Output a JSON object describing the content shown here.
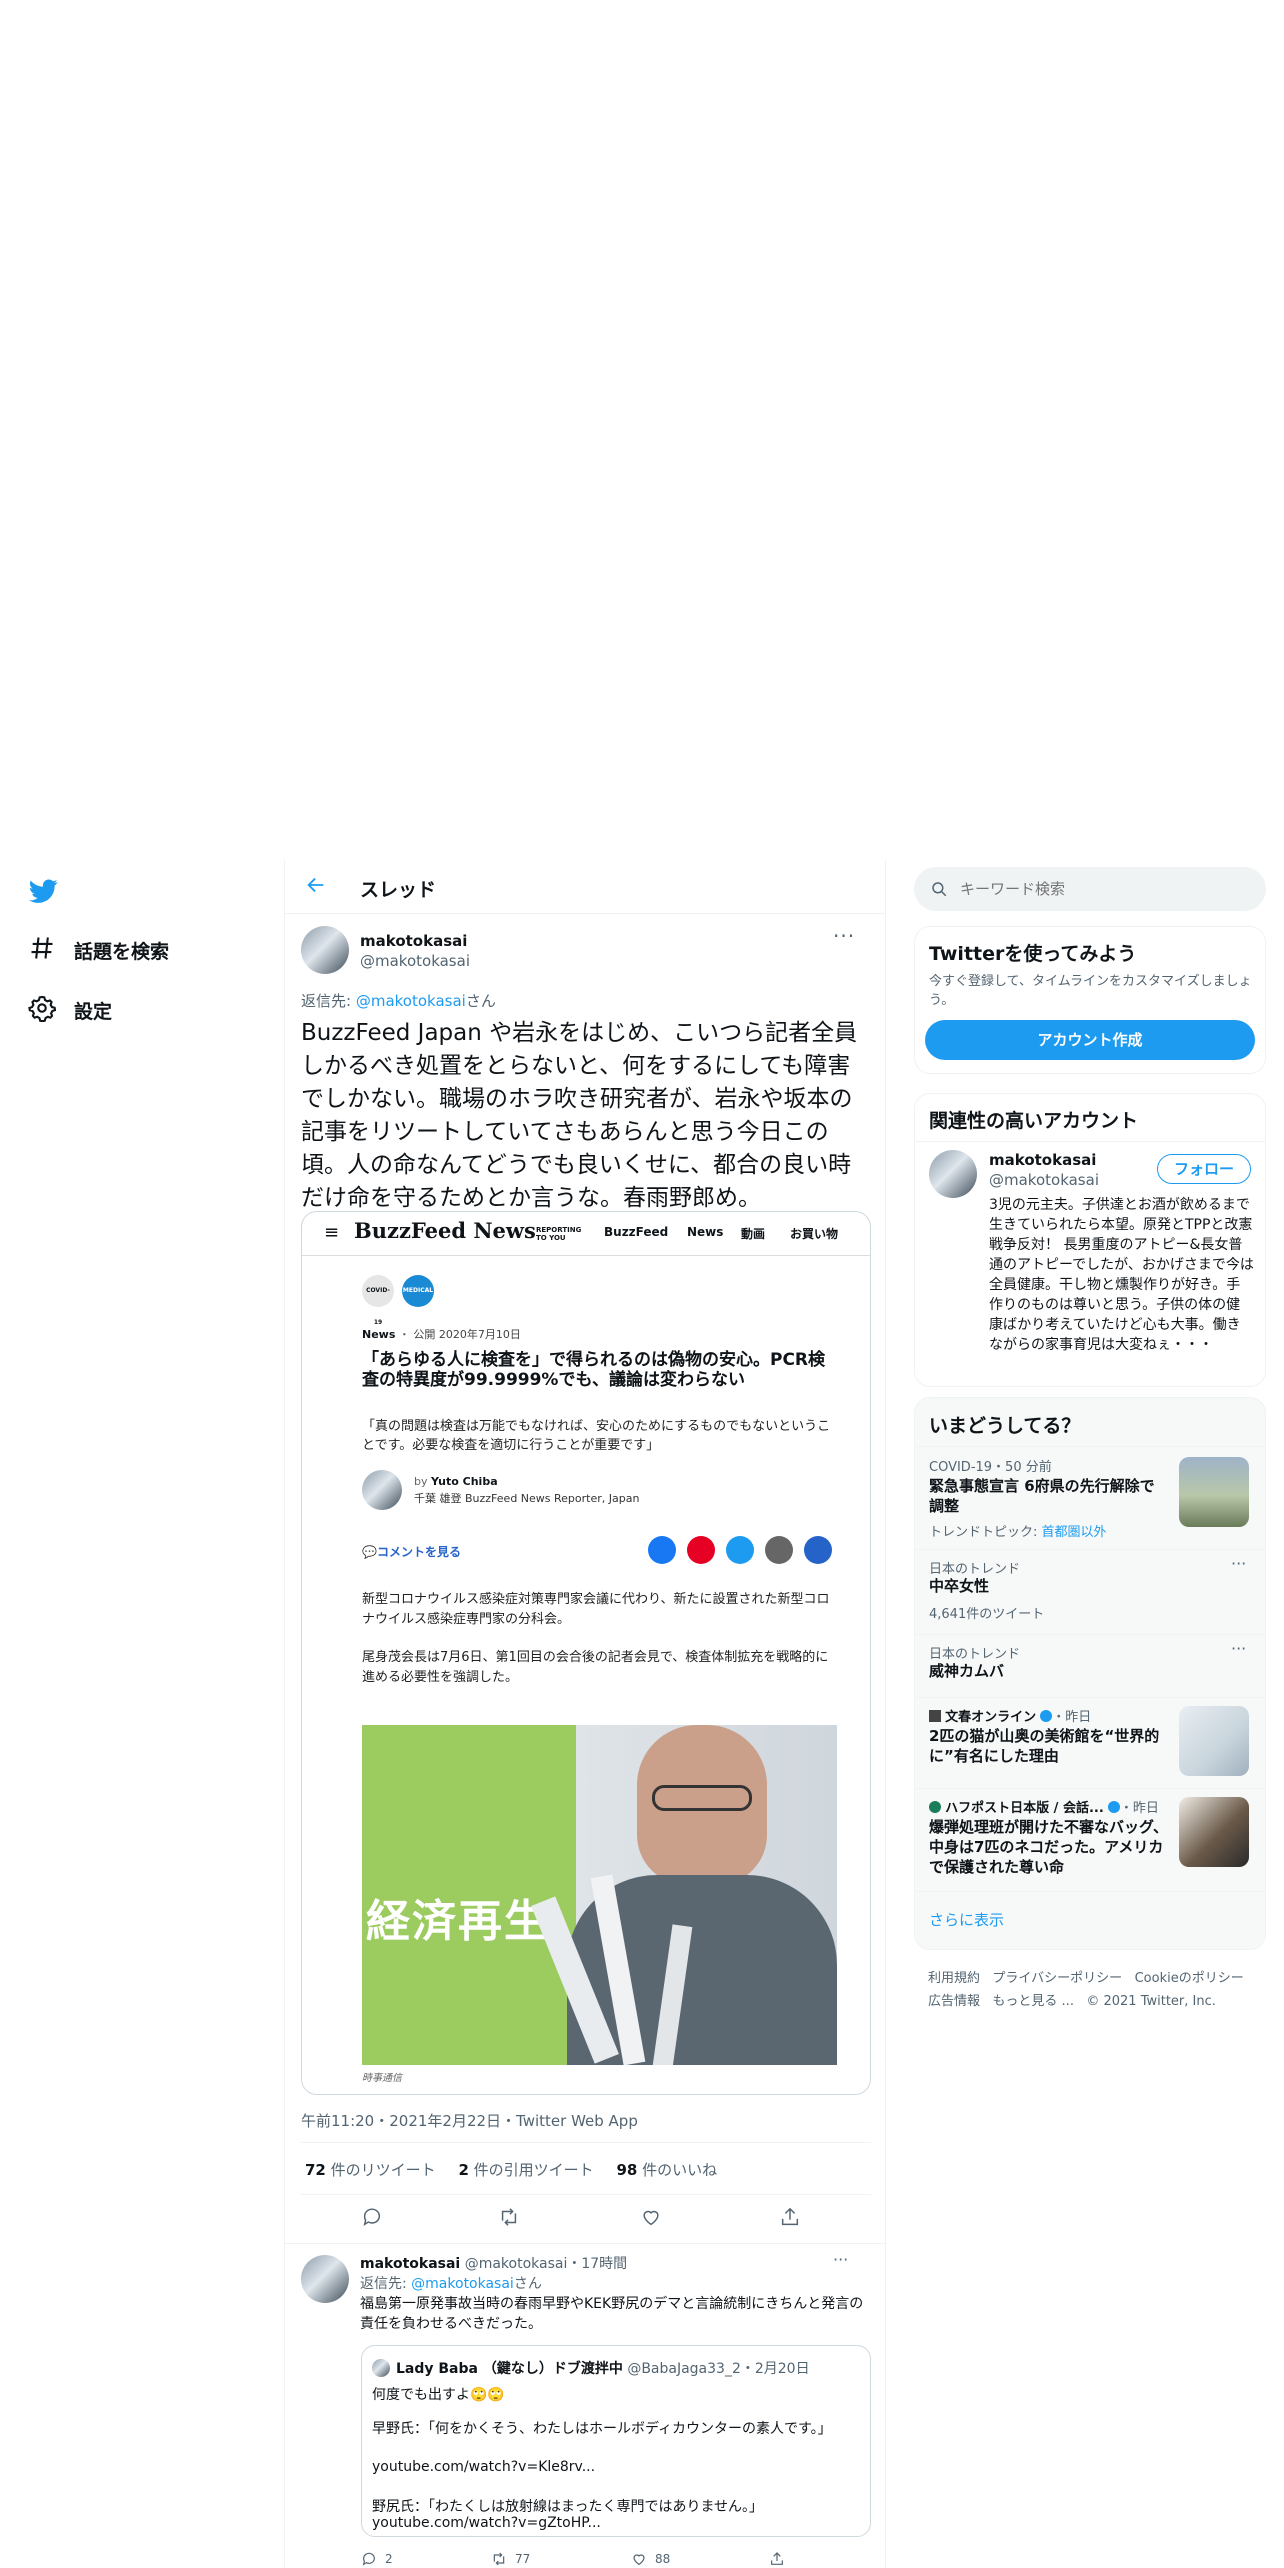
{
  "nav": {
    "items": [
      {
        "label": "話題を検索",
        "icon": "hashtag-icon"
      },
      {
        "label": "設定",
        "icon": "gear-icon"
      }
    ]
  },
  "header": {
    "title": "スレッド"
  },
  "main_tweet": {
    "display_name": "makotokasai",
    "handle": "@makotokasai",
    "reply_prefix": "返信先: ",
    "reply_to": "@makotokasai",
    "reply_suffix": "さん",
    "text": "BuzzFeed Japan や岩永をはじめ、こいつら記者全員しかるべき処置をとらないと、何をするにしても障害でしかない。職場のホラ吹き研究者が、岩永や坂本の記事をリツートしていてさもあらんと思う今日この頃。人の命なんてどうでも良いくせに、都合の良い時だけ命を守るためとか言うな。春雨野郎め。",
    "timestamp": "午前11:20・2021年2月22日・Twitter Web App",
    "stats": {
      "retweets_count": "72",
      "retweets_label": "件のリツイート",
      "quotes_count": "2",
      "quotes_label": "件の引用ツイート",
      "likes_count": "98",
      "likes_label": "件のいいね"
    }
  },
  "article": {
    "logo": "BuzzFeed News",
    "logo_sub": "REPORTING TO YOU",
    "nav": [
      "BuzzFeed",
      "News",
      "動画",
      "お買い物"
    ],
    "badge1": "COVID-19",
    "badge2": "MEDICAL",
    "category": "News",
    "date": "公開 2020年7月10日",
    "headline": "「あらゆる人に検査を」で得られるのは偽物の安心。PCR検査の特異度が99.9999%でも、議論は変わらない",
    "lede": "「真の問題は検査は万能でもなければ、安心のためにするものでもないということです。必要な検査を適切に行うことが重要です」",
    "byline_prefix": "by",
    "author": "Yuto Chiba",
    "author_title": "千葉 雄登 BuzzFeed News Reporter, Japan",
    "comment_link": "コメントを見る",
    "para1": "新型コロナウイルス感染症対策専門家会議に代わり、新たに設置された新型コロナウイルス感染症専門家の分科会。",
    "para2": "尾身茂会長は7月6日、第1回目の会合後の記者会見で、検査体制拡充を戦略的に進める必要性を強調した。",
    "photo_sign": "経済再生",
    "photo_credit": "時事通信"
  },
  "reply_tweet": {
    "display_name": "makotokasai",
    "meta": "@makotokasai・17時間",
    "reply_prefix": "返信先: ",
    "reply_to": "@makotokasai",
    "reply_suffix": "さん",
    "text": "福島第一原発事故当時の春雨早野やKEK野尻のデマと言論統制にきちんと発言の責任を負わせるべきだった。",
    "quote": {
      "name": "Lady Baba （鍵なし）ドブ渡拌中",
      "meta": "@BabaJaga33_2・2月20日",
      "line1": "何度でも出すよ🙄🙄",
      "line2": "早野氏：「何をかくそう、わたしはホールボディカウンターの素人です。」",
      "link1": "youtube.com/watch?v=Kle8rv...",
      "line3": "野尻氏：「わたくしは放射線はまったく専門ではありません。」",
      "link2": "youtube.com/watch?v=gZtoHP..."
    },
    "reply_count": "2",
    "retweet_count": "77",
    "like_count": "88"
  },
  "search": {
    "placeholder": "キーワード検索"
  },
  "signup": {
    "title": "Twitterを使ってみよう",
    "desc": "今すぐ登録して、タイムラインをカスタマイズしましょう。",
    "button": "アカウント作成"
  },
  "related": {
    "title": "関連性の高いアカウント",
    "name": "makotokasai",
    "handle": "@makotokasai",
    "follow": "フォロー",
    "bio": "3児の元主夫。子供達とお酒が飲めるまで生きていられたら本望。原発とTPPと改憲戦争反対！ 長男重度のアトピー&長女普通のアトピーでしたが、おかげさまで今は全員健康。干し物と燻製作りが好き。手作りのものは尊いと思う。子供の体の健康ばかり考えていたけど心も大事。働きながらの家事育児は大変ねぇ・・・"
  },
  "trends": {
    "title": "いまどうしてる？",
    "items": [
      {
        "meta": "COVID-19・50 分前",
        "title": "緊急事態宣言 6府県の先行解除で調整",
        "extra_label": "トレンドトピック: ",
        "extra_link": "首都圏以外"
      },
      {
        "meta": "日本のトレンド",
        "title": "中卒女性",
        "count": "4,641件のツイート"
      },
      {
        "meta": "日本のトレンド",
        "title": "威神カムバ"
      },
      {
        "source": "文春オンライン",
        "time": "・昨日",
        "title": "2匹の猫が山奥の美術館を“世界的に”有名にした理由"
      },
      {
        "source": "ハフポスト日本版 / 会話...",
        "time": "・昨日",
        "title": "爆弾処理班が開けた不審なバッグ、中身は7匹のネコだった。アメリカで保護された尊い命"
      }
    ],
    "more": "さらに表示"
  },
  "footer": {
    "links1": [
      "利用規約",
      "プライバシーポリシー",
      "Cookieのポリシー"
    ],
    "links2": [
      "広告情報",
      "もっと見る ..."
    ],
    "copyright": "© 2021 Twitter, Inc."
  },
  "colors": {
    "accent": "#1d9bf0",
    "text": "#0f1419",
    "muted": "#536471",
    "border": "#eff3f4"
  }
}
